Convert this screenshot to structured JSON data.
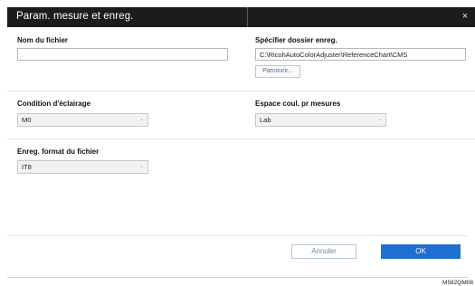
{
  "dialog": {
    "title": "Param. mesure et enreg.",
    "close_glyph": "×"
  },
  "file_name": {
    "label": "Nom du fichier",
    "value": ""
  },
  "save_folder": {
    "label": "Spécifier dossier enreg.",
    "value": "C:\\RicohAutoColorAdjuster\\ReferenceChart\\CMS",
    "browse_label": "Parcourir..."
  },
  "lighting": {
    "label": "Condition d'éclairage",
    "selected": "M0"
  },
  "color_space": {
    "label": "Espace coul. pr mesures",
    "selected": "Lab"
  },
  "file_format": {
    "label": "Enreg. format du fichier",
    "selected": "IT8"
  },
  "footer": {
    "cancel_label": "Annuler",
    "ok_label": "OK"
  },
  "figure_code": "M582QM08",
  "icons": {
    "dropdown": "chevron-down-icon",
    "close": "close-icon"
  },
  "colors": {
    "titlebar": "#1c1c1c",
    "primary": "#1e6fd0"
  }
}
